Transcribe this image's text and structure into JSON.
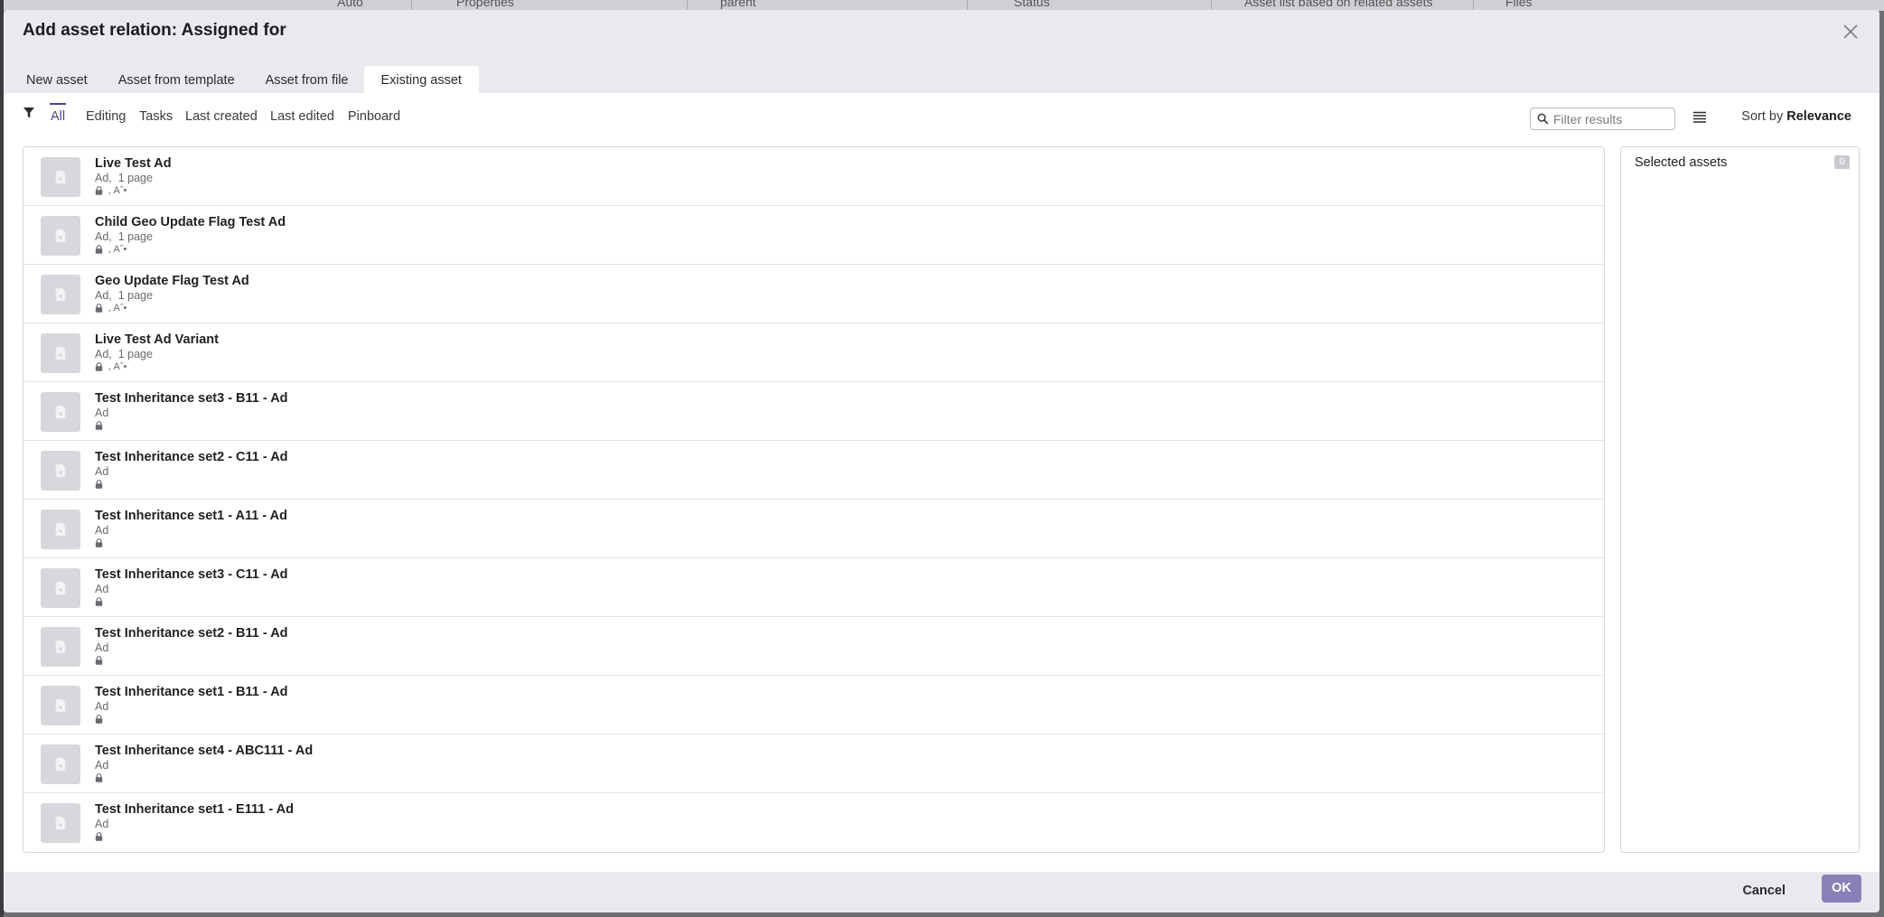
{
  "background": {
    "columns": [
      "Properties",
      "parent",
      "Status",
      "Asset list based on related assets",
      "Files"
    ],
    "zoom_label": "Auto"
  },
  "dialog": {
    "title": "Add asset relation: Assigned for",
    "close_icon": "close-icon"
  },
  "tabs": [
    {
      "label": "New asset"
    },
    {
      "label": "Asset from template"
    },
    {
      "label": "Asset from file"
    },
    {
      "label": "Existing asset",
      "active": true
    }
  ],
  "filter_tabs": [
    {
      "label": "All",
      "active": true
    },
    {
      "label": "Editing"
    },
    {
      "label": "Tasks"
    },
    {
      "label": "Last created"
    },
    {
      "label": "Last edited"
    },
    {
      "label": "Pinboard"
    }
  ],
  "search": {
    "placeholder": "Filter results",
    "value": ""
  },
  "sort": {
    "prefix": "Sort by",
    "value": "Relevance"
  },
  "results": [
    {
      "title": "Live Test Ad",
      "type": "Ad,",
      "pages": "1 page",
      "meta": ", Aˆ•"
    },
    {
      "title": "Child Geo Update Flag Test Ad",
      "type": "Ad,",
      "pages": "1 page",
      "meta": ", Aˆ•"
    },
    {
      "title": "Geo Update Flag Test Ad",
      "type": "Ad,",
      "pages": "1 page",
      "meta": ", Aˆ•"
    },
    {
      "title": "Live Test Ad Variant",
      "type": "Ad,",
      "pages": "1 page",
      "meta": ", Aˆ•"
    },
    {
      "title": "Test Inheritance set3 - B11 - Ad",
      "type": "Ad",
      "pages": "",
      "meta": ""
    },
    {
      "title": "Test Inheritance set2 - C11 - Ad",
      "type": "Ad",
      "pages": "",
      "meta": ""
    },
    {
      "title": "Test Inheritance set1 - A11 - Ad",
      "type": "Ad",
      "pages": "",
      "meta": ""
    },
    {
      "title": "Test Inheritance set3 - C11 - Ad",
      "type": "Ad",
      "pages": "",
      "meta": ""
    },
    {
      "title": "Test Inheritance set2 - B11 - Ad",
      "type": "Ad",
      "pages": "",
      "meta": ""
    },
    {
      "title": "Test Inheritance set1 - B11 - Ad",
      "type": "Ad",
      "pages": "",
      "meta": ""
    },
    {
      "title": "Test Inheritance set4 - ABC111 - Ad",
      "type": "Ad",
      "pages": "",
      "meta": ""
    },
    {
      "title": "Test Inheritance set1 - E111 - Ad",
      "type": "Ad",
      "pages": "",
      "meta": ""
    }
  ],
  "selected_panel": {
    "title": "Selected assets",
    "count": "0"
  },
  "footer": {
    "cancel_label": "Cancel",
    "ok_label": "OK"
  },
  "colors": {
    "accent": "#4e3f95",
    "ok_button": "#8a80b8",
    "dialog_bg": "#e8eaee"
  }
}
